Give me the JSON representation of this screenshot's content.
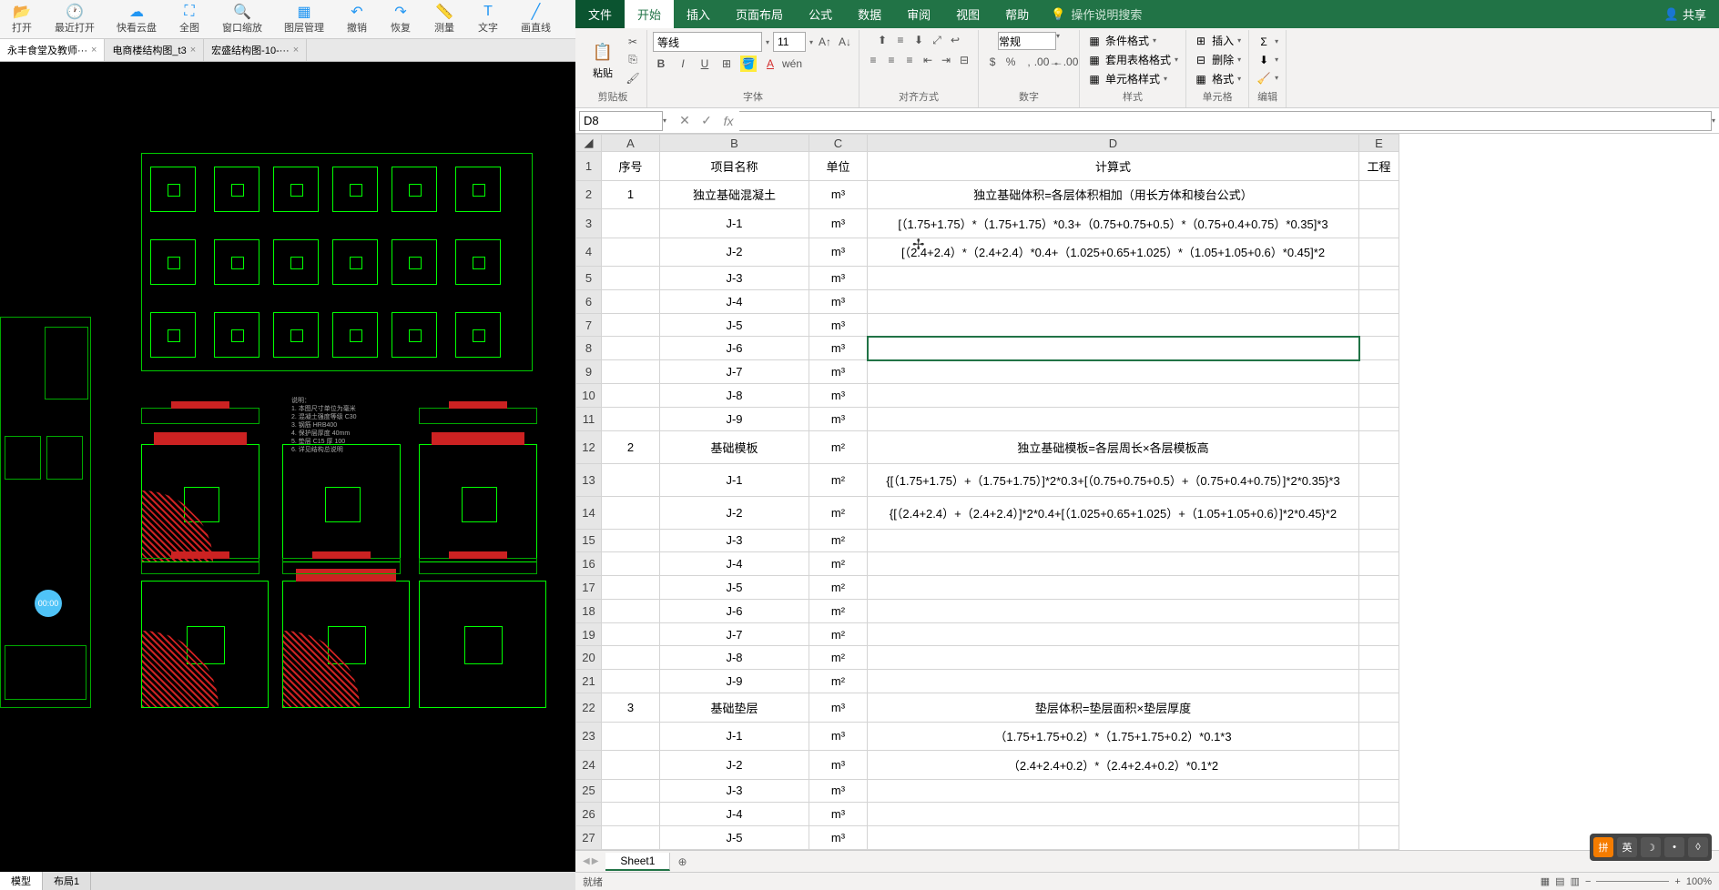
{
  "cad": {
    "tools": [
      {
        "icon": "📂",
        "label": "打开"
      },
      {
        "icon": "🕐",
        "label": "最近打开"
      },
      {
        "icon": "☁",
        "label": "快看云盘"
      },
      {
        "icon": "⛶",
        "label": "全图"
      },
      {
        "icon": "🔍",
        "label": "窗口缩放"
      },
      {
        "icon": "▦",
        "label": "图层管理"
      },
      {
        "icon": "↶",
        "label": "撤销"
      },
      {
        "icon": "↷",
        "label": "恢复"
      },
      {
        "icon": "📏",
        "label": "测量"
      },
      {
        "icon": "T",
        "label": "文字"
      },
      {
        "icon": "╱",
        "label": "画直线"
      }
    ],
    "tabs": [
      {
        "label": "永丰食堂及教师···",
        "active": true
      },
      {
        "label": "电商楼结构图_t3",
        "active": false
      },
      {
        "label": "宏盛结构图-10-···",
        "active": false
      }
    ],
    "time_badge": "00:00",
    "footer_tabs": [
      {
        "label": "模型",
        "active": true
      },
      {
        "label": "布局1",
        "active": false
      }
    ]
  },
  "excel": {
    "menu": {
      "file": "文件",
      "items": [
        "开始",
        "插入",
        "页面布局",
        "公式",
        "数据",
        "审阅",
        "视图",
        "帮助"
      ],
      "search": "操作说明搜索",
      "share": "共享"
    },
    "ribbon": {
      "paste": "粘贴",
      "clipboard_label": "剪贴板",
      "font_name": "等线",
      "font_size": "11",
      "font_label": "字体",
      "align_label": "对齐方式",
      "number_format": "常规",
      "number_label": "数字",
      "cond_format": "条件格式",
      "table_format": "套用表格格式",
      "cell_style": "单元格样式",
      "style_label": "样式",
      "insert": "插入",
      "delete": "删除",
      "format": "格式",
      "cells_label": "单元格",
      "edit_label": "编辑"
    },
    "name_box": "D8",
    "formula_value": "",
    "columns": [
      "A",
      "B",
      "C",
      "D",
      "E"
    ],
    "headers": {
      "A": "序号",
      "B": "项目名称",
      "C": "单位",
      "D": "计算式",
      "E": "工程"
    },
    "rows": [
      {
        "n": 1,
        "A": "序号",
        "B": "项目名称",
        "C": "单位",
        "D": "计算式",
        "E": "工程"
      },
      {
        "n": 2,
        "A": "1",
        "B": "独立基础混凝土",
        "C": "m³",
        "D": "独立基础体积=各层体积相加（用长方体和棱台公式）"
      },
      {
        "n": 3,
        "B": "J-1",
        "C": "m³",
        "D": "[（1.75+1.75）*（1.75+1.75）*0.3+（0.75+0.75+0.5）*（0.75+0.4+0.75）*0.35]*3"
      },
      {
        "n": 4,
        "B": "J-2",
        "C": "m³",
        "D": "[（2.4+2.4）*（2.4+2.4）*0.4+（1.025+0.65+1.025）*（1.05+1.05+0.6）*0.45]*2"
      },
      {
        "n": 5,
        "B": "J-3",
        "C": "m³"
      },
      {
        "n": 6,
        "B": "J-4",
        "C": "m³"
      },
      {
        "n": 7,
        "B": "J-5",
        "C": "m³"
      },
      {
        "n": 8,
        "B": "J-6",
        "C": "m³",
        "selected": true
      },
      {
        "n": 9,
        "B": "J-7",
        "C": "m³"
      },
      {
        "n": 10,
        "B": "J-8",
        "C": "m³"
      },
      {
        "n": 11,
        "B": "J-9",
        "C": "m³"
      },
      {
        "n": 12,
        "A": "2",
        "B": "基础模板",
        "C": "m²",
        "D": "独立基础模板=各层周长×各层模板高",
        "tall": true
      },
      {
        "n": 13,
        "B": "J-1",
        "C": "m²",
        "D": "{[（1.75+1.75）+（1.75+1.75）]*2*0.3+[（0.75+0.75+0.5）+（0.75+0.4+0.75）]*2*0.35}*3",
        "tall": true
      },
      {
        "n": 14,
        "B": "J-2",
        "C": "m²",
        "D": "{[（2.4+2.4）+（2.4+2.4）]*2*0.4+[（1.025+0.65+1.025）+（1.05+1.05+0.6）]*2*0.45}*2",
        "tall": true
      },
      {
        "n": 15,
        "B": "J-3",
        "C": "m²"
      },
      {
        "n": 16,
        "B": "J-4",
        "C": "m²"
      },
      {
        "n": 17,
        "B": "J-5",
        "C": "m²"
      },
      {
        "n": 18,
        "B": "J-6",
        "C": "m²"
      },
      {
        "n": 19,
        "B": "J-7",
        "C": "m²"
      },
      {
        "n": 20,
        "B": "J-8",
        "C": "m²"
      },
      {
        "n": 21,
        "B": "J-9",
        "C": "m²"
      },
      {
        "n": 22,
        "A": "3",
        "B": "基础垫层",
        "C": "m³",
        "D": "垫层体积=垫层面积×垫层厚度"
      },
      {
        "n": 23,
        "B": "J-1",
        "C": "m³",
        "D": "（1.75+1.75+0.2）*（1.75+1.75+0.2）*0.1*3"
      },
      {
        "n": 24,
        "B": "J-2",
        "C": "m³",
        "D": "（2.4+2.4+0.2）*（2.4+2.4+0.2）*0.1*2"
      },
      {
        "n": 25,
        "B": "J-3",
        "C": "m³"
      },
      {
        "n": 26,
        "B": "J-4",
        "C": "m³"
      },
      {
        "n": 27,
        "B": "J-5",
        "C": "m³"
      }
    ],
    "sheet_tab": "Sheet1",
    "status_left": "就绪",
    "zoom": "100%",
    "ime": [
      "拼",
      "英",
      "☽",
      "•",
      "◊"
    ]
  }
}
